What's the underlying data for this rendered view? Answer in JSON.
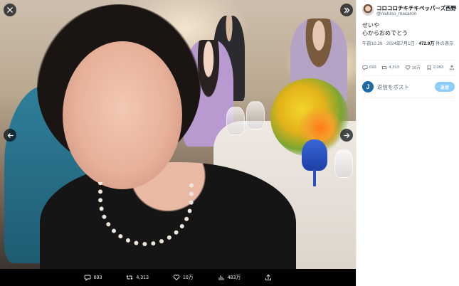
{
  "viewer": {
    "close_icon": "close-icon",
    "expand_icon": "double-chevron-right-icon",
    "prev_icon": "arrow-left-icon",
    "next_icon": "arrow-right-icon",
    "actions": [
      {
        "name": "reply",
        "icon": "reply-icon",
        "count": "693"
      },
      {
        "name": "retweet",
        "icon": "retweet-icon",
        "count": "4,313"
      },
      {
        "name": "like",
        "icon": "heart-icon",
        "count": "10万"
      },
      {
        "name": "views",
        "icon": "views-icon",
        "count": "483万"
      },
      {
        "name": "share",
        "icon": "share-icon",
        "count": ""
      }
    ]
  },
  "tweet": {
    "author_name": "コロコロチキチキペッパーズ西野",
    "author_handle": "@nishino_macaron",
    "more_icon": "more-icon",
    "text_line1": "せいや",
    "text_line2": "心からおめでとう",
    "timestamp": "午前10:26 · 2024年7月1日 · ",
    "views_count": "472.9万",
    "views_suffix": " 件の表示",
    "stats": [
      {
        "name": "reply",
        "icon": "reply-icon",
        "count": "693"
      },
      {
        "name": "retweet",
        "icon": "retweet-icon",
        "count": "4,313"
      },
      {
        "name": "like",
        "icon": "heart-icon",
        "count": "10万"
      },
      {
        "name": "bookmark",
        "icon": "bookmark-icon",
        "count": "2,093"
      },
      {
        "name": "share",
        "icon": "share-icon",
        "count": ""
      }
    ],
    "reply_avatar_letter": "J",
    "reply_placeholder": "返信をポスト",
    "reply_button": "返信"
  },
  "colors": {
    "accent": "#1d9bf0",
    "reply_button_disabled": "#8ecdf8",
    "text_primary": "#0f1419",
    "text_secondary": "#536471"
  }
}
